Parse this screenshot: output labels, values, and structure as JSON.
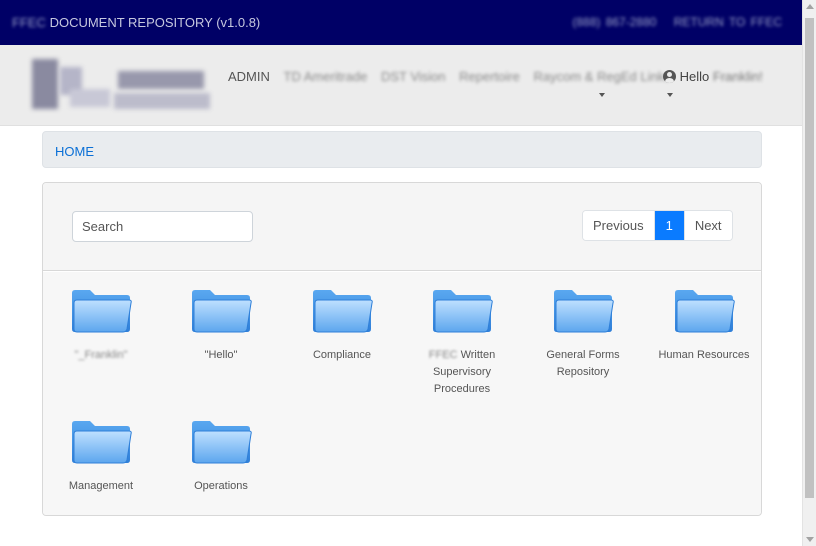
{
  "topbar": {
    "title_prefix": "FFEC",
    "title_rest": " DOCUMENT REPOSITORY (v1.0.8)",
    "phone": "(888) 867-2880",
    "return_link": "RETURN TO FFEC"
  },
  "nav": {
    "admin": "ADMIN",
    "items": [
      "TD Ameritrade",
      "DST Vision",
      "Repertoire",
      "Raycom & RegEd Links"
    ],
    "user_greeting": "Hello",
    "user_name": "Franklin!"
  },
  "breadcrumb": {
    "home": "HOME"
  },
  "search": {
    "placeholder": "Search",
    "value": ""
  },
  "pagination": {
    "previous": "Previous",
    "current": "1",
    "next": "Next"
  },
  "folders": [
    {
      "line1": "\"_Franklin\"",
      "line2": "",
      "line3": "",
      "blurred": true
    },
    {
      "line1": "\"Hello\"",
      "line2": "",
      "line3": ""
    },
    {
      "line1": "Compliance",
      "line2": "",
      "line3": ""
    },
    {
      "prefix": "FFEC",
      "line1": " Written",
      "line2": "Supervisory",
      "line3": "Procedures"
    },
    {
      "line1": "General Forms",
      "line2": "Repository",
      "line3": ""
    },
    {
      "line1": "Human Resources",
      "line2": "",
      "line3": ""
    },
    {
      "line1": "Management",
      "line2": "",
      "line3": ""
    },
    {
      "line1": "Operations",
      "line2": "",
      "line3": ""
    }
  ],
  "colors": {
    "topbar": "#000066",
    "accent": "#0a7bff",
    "link": "#0a6fd6"
  }
}
